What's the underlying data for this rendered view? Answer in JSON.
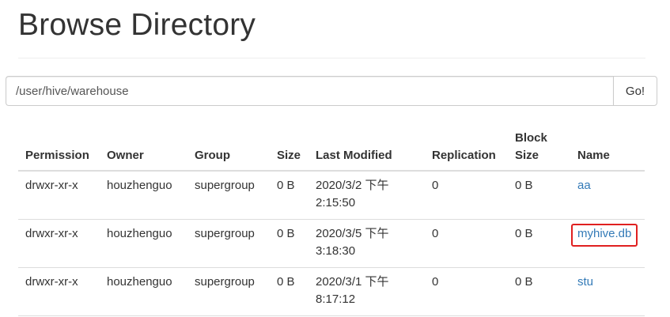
{
  "header": {
    "title": "Browse Directory"
  },
  "path_bar": {
    "value": "/user/hive/warehouse",
    "go_label": "Go!"
  },
  "table": {
    "headers": {
      "permission": "Permission",
      "owner": "Owner",
      "group": "Group",
      "size": "Size",
      "last_modified": "Last Modified",
      "replication": "Replication",
      "block_size": "Block Size",
      "name": "Name"
    },
    "rows": [
      {
        "permission": "drwxr-xr-x",
        "owner": "houzhenguo",
        "group": "supergroup",
        "size": "0 B",
        "last_modified": "2020/3/2 下午 2:15:50",
        "replication": "0",
        "block_size": "0 B",
        "name": "aa"
      },
      {
        "permission": "drwxr-xr-x",
        "owner": "houzhenguo",
        "group": "supergroup",
        "size": "0 B",
        "last_modified": "2020/3/5 下午 3:18:30",
        "replication": "0",
        "block_size": "0 B",
        "name": "myhive.db"
      },
      {
        "permission": "drwxr-xr-x",
        "owner": "houzhenguo",
        "group": "supergroup",
        "size": "0 B",
        "last_modified": "2020/3/1 下午 8:17:12",
        "replication": "0",
        "block_size": "0 B",
        "name": "stu"
      }
    ]
  },
  "colors": {
    "link": "#337ab7",
    "highlight_box": "#e02020"
  }
}
